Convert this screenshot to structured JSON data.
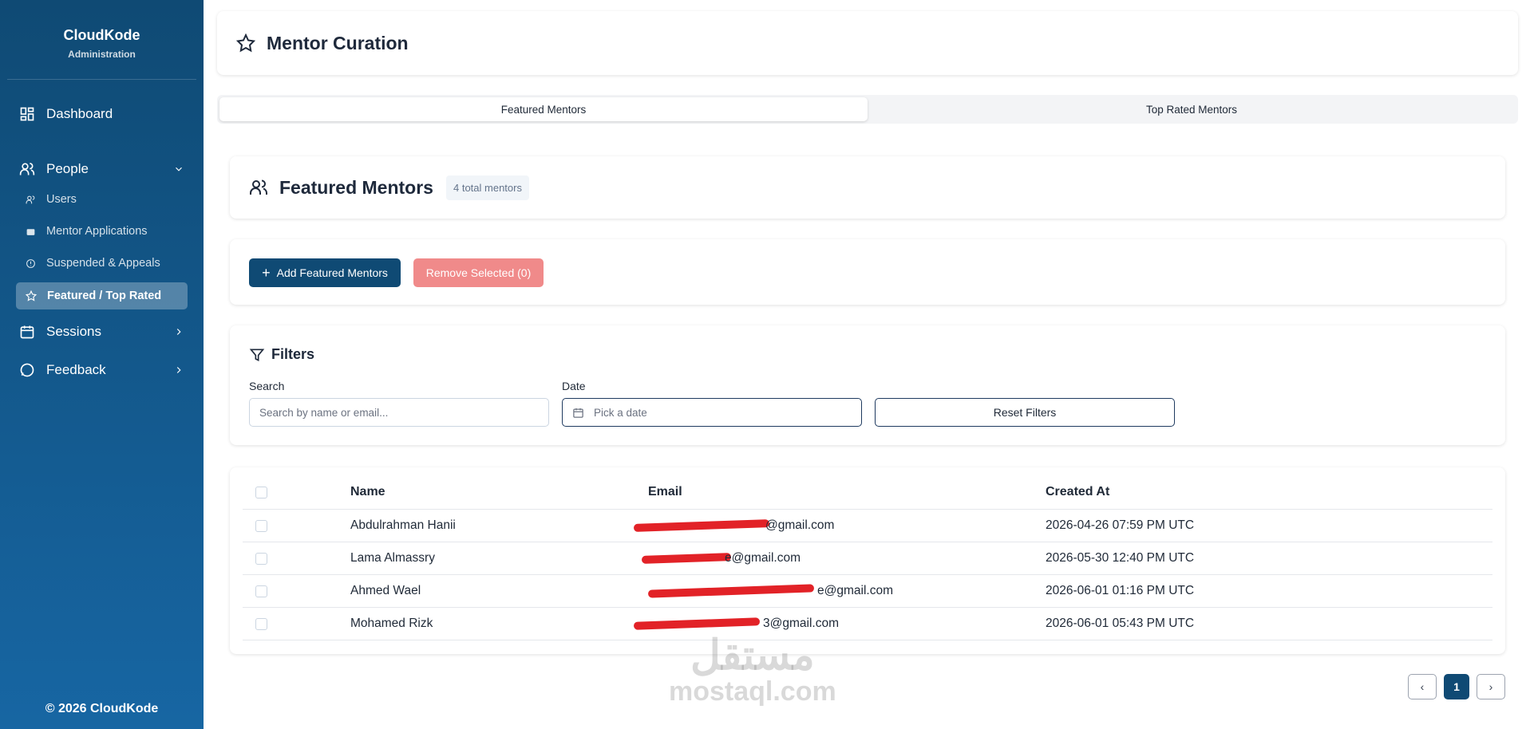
{
  "sidebar": {
    "brand_title": "CloudKode",
    "brand_sub": "Administration",
    "dashboard": "Dashboard",
    "people": "People",
    "users": "Users",
    "mentor_applications": "Mentor Applications",
    "suspended": "Suspended & Appeals",
    "featured": "Featured / Top Rated",
    "sessions": "Sessions",
    "feedback": "Feedback",
    "footer": "© 2026 CloudKode"
  },
  "header": {
    "title": "Mentor Curation"
  },
  "tabs": [
    {
      "label": "Featured Mentors",
      "active": true
    },
    {
      "label": "Top Rated Mentors",
      "active": false
    }
  ],
  "featured": {
    "title": "Featured Mentors",
    "badge": "4 total mentors"
  },
  "actions": {
    "add_label": "Add Featured Mentors",
    "remove_label": "Remove Selected (0)"
  },
  "filters": {
    "title": "Filters",
    "search_label": "Search",
    "search_placeholder": "Search by name or email...",
    "date_label": "Date",
    "date_placeholder": "Pick a date",
    "reset_label": "Reset Filters"
  },
  "table": {
    "headers": {
      "name": "Name",
      "email": "Email",
      "created": "Created At"
    },
    "rows": [
      {
        "name": "Abdulrahman Hanii",
        "email": "@gmail.com",
        "created": "2026-04-26 07:59 PM UTC"
      },
      {
        "name": "Lama Almassry",
        "email": "e@gmail.com",
        "created": "2026-05-30 12:40 PM UTC"
      },
      {
        "name": "Ahmed Wael",
        "email": "e@gmail.com",
        "created": "2026-06-01 01:16 PM UTC"
      },
      {
        "name": "Mohamed Rizk",
        "email": "3@gmail.com",
        "created": "2026-06-01 05:43 PM UTC"
      }
    ]
  },
  "pagination": {
    "prev": "‹",
    "page": "1",
    "next": "›"
  },
  "watermark": {
    "arabic": "مستقل",
    "latin": "mostaql.com"
  },
  "colors": {
    "sidebar": "#0f4a74",
    "primary": "#0f4a74",
    "danger": "#f08a8a"
  }
}
